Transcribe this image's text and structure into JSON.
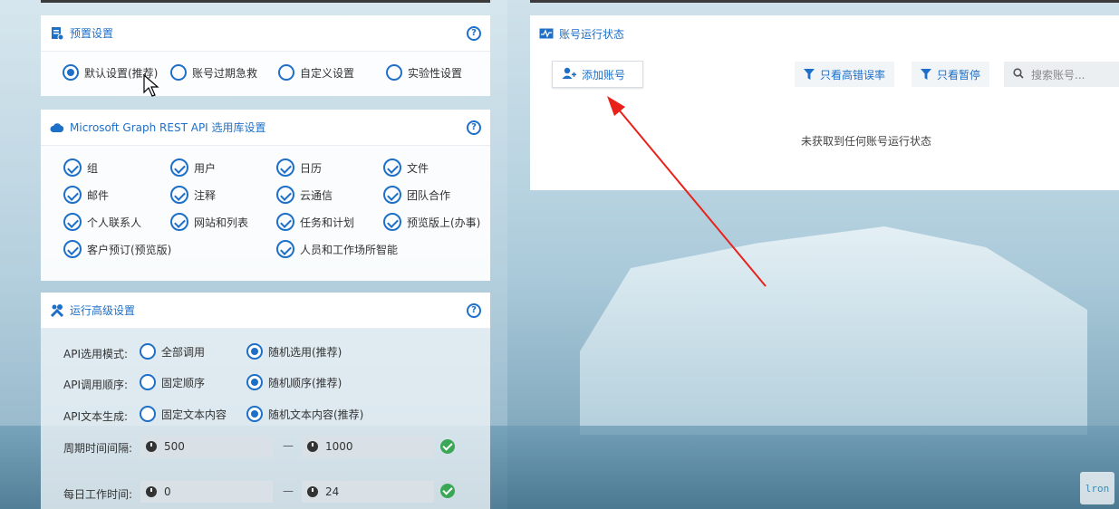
{
  "preset_panel": {
    "title": "预置设置",
    "options": [
      {
        "label": "默认设置(推荐)",
        "selected": true
      },
      {
        "label": "账号过期急救",
        "selected": false
      },
      {
        "label": "自定义设置",
        "selected": false
      },
      {
        "label": "实验性设置",
        "selected": false
      }
    ]
  },
  "graph_panel": {
    "title": "Microsoft Graph REST API 选用库设置",
    "items": [
      "组",
      "用户",
      "日历",
      "文件",
      "邮件",
      "注释",
      "云通信",
      "团队合作",
      "个人联系人",
      "网站和列表",
      "任务和计划",
      "预览版上(办事)",
      "客户预订(预览版)",
      "人员和工作场所智能"
    ]
  },
  "advanced_panel": {
    "title": "运行高级设置",
    "api_mode": {
      "label": "API选用模式:",
      "opt1": "全部调用",
      "opt2": "随机选用(推荐)",
      "selected": 2
    },
    "api_order": {
      "label": "API调用顺序:",
      "opt1": "固定顺序",
      "opt2": "随机顺序(推荐)",
      "selected": 2
    },
    "api_text": {
      "label": "API文本生成:",
      "opt1": "固定文本内容",
      "opt2": "随机文本内容(推荐)",
      "selected": 2
    },
    "interval": {
      "label": "周期时间间隔:",
      "min": "500",
      "max": "1000"
    },
    "work_time": {
      "label": "每日工作时间:",
      "min": "0",
      "max": "24"
    },
    "separator": "—"
  },
  "status_panel": {
    "title": "账号运行状态",
    "add_button": "添加账号",
    "filter_error": "只看高错误率",
    "filter_paused": "只看暂停",
    "search_placeholder": "搜索账号...",
    "empty_message": "未获取到任何账号运行状态"
  },
  "colors": {
    "accent": "#1e6fc8",
    "success": "#3aa757",
    "arrow": "#e8221b"
  },
  "watermark": "lron"
}
